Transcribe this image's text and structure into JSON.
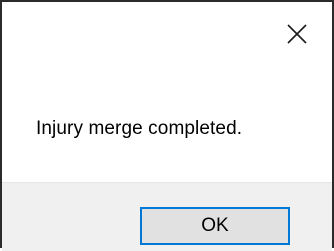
{
  "window": {
    "title": "",
    "close_icon": "close-icon"
  },
  "dialog": {
    "message": "Injury merge completed.",
    "ok_label": "OK"
  },
  "colors": {
    "accent": "#0078d7",
    "footer_bg": "#f0f0f0",
    "button_bg": "#e1e1e1"
  }
}
